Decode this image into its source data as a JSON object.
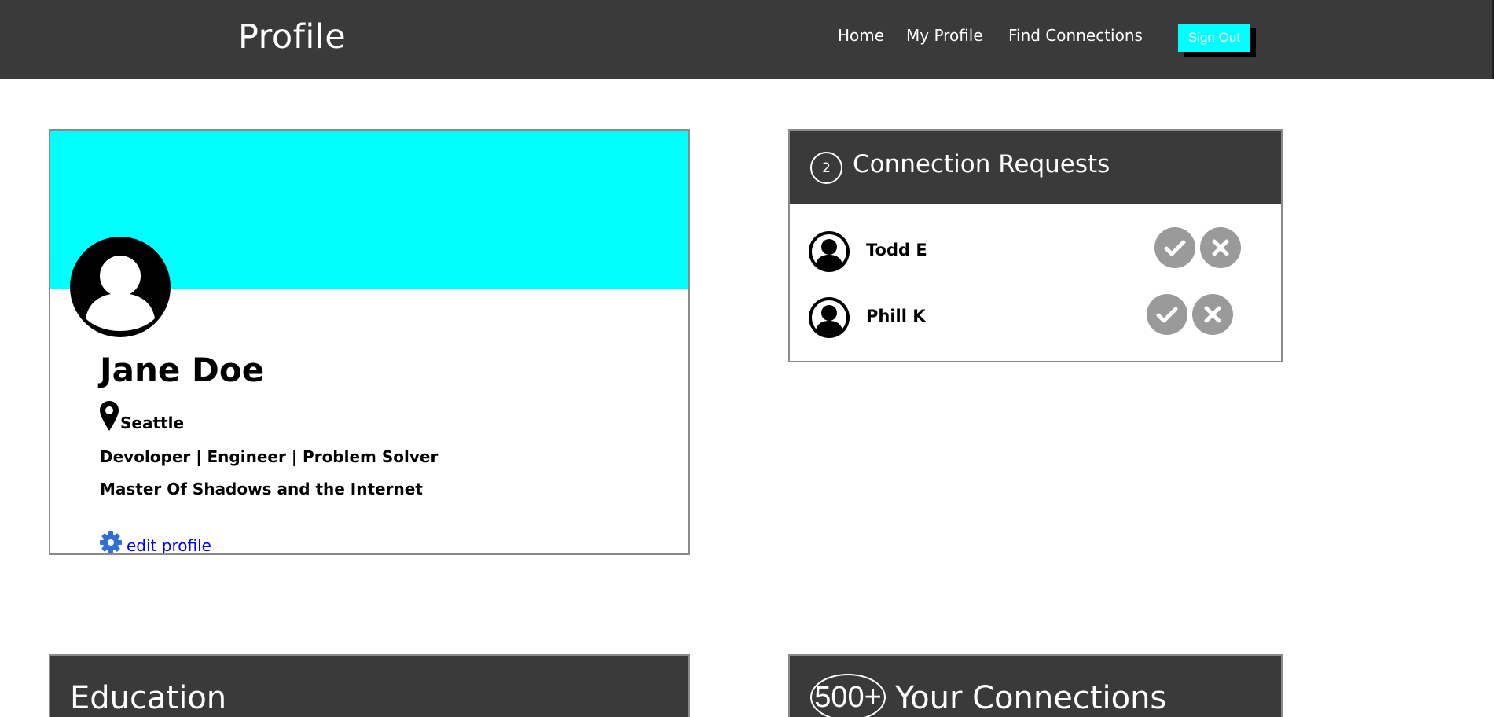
{
  "navbar": {
    "title": "Profile",
    "links": [
      "Home",
      "My Profile",
      "Find Connections"
    ],
    "signout_label": "Sign Out"
  },
  "profile": {
    "name": "Jane Doe",
    "location": "Seattle",
    "bio_line_1": "Devoloper | Engineer | Problem Solver",
    "bio_line_2": "Master Of Shadows and the Internet",
    "edit_label": "edit profile",
    "cover_color": "#00ffff",
    "icons": [
      "user-avatar-icon",
      "map-pin-icon",
      "gear-icon"
    ]
  },
  "requests": {
    "count": "2",
    "title": "Connection Requests",
    "items": [
      {
        "name": "Todd E"
      },
      {
        "name": "Phill K"
      }
    ],
    "action_icons": [
      "check-icon",
      "x-icon"
    ]
  },
  "education": {
    "title": "Education"
  },
  "connections": {
    "count": "500+",
    "title": "Your Connections"
  },
  "colors": {
    "header_bg": "#3a3a3a",
    "accent": "#00ffff",
    "link": "#0000ff",
    "gear": "#2f6fd6",
    "action_button": "#9a9a9a"
  }
}
